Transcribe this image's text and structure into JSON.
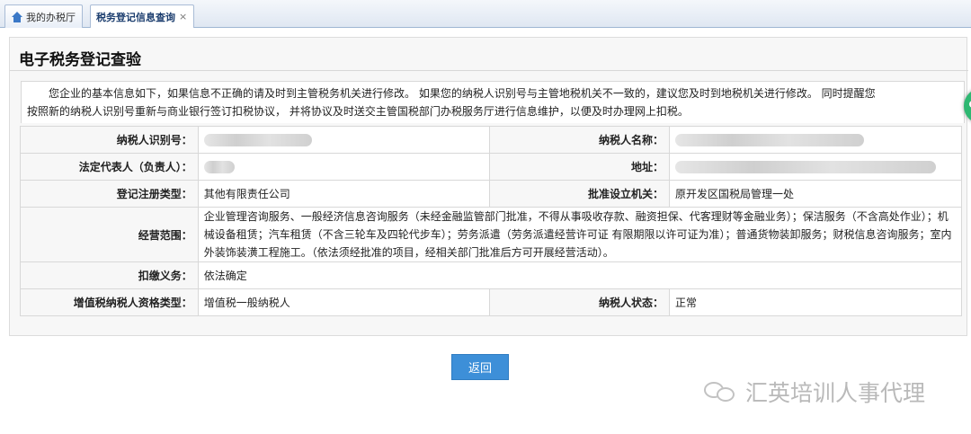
{
  "tabs": {
    "home_label": "我的办税厅",
    "active_label": "税务登记信息查询",
    "close_glyph": "×"
  },
  "panel": {
    "title": "电子税务登记查验",
    "notice_line1": "您企业的基本信息如下，如果信息不正确的请及时到主管税务机关进行修改。 如果您的纳税人识别号与主管地税机关不一致的，建议您及时到地税机关进行修改。 同时提醒您",
    "notice_line2": "按照新的纳税人识别号重新与商业银行签订扣税协议， 并将协议及时送交主管国税部门办税服务厅进行信息维护，以便及时办理网上扣税。"
  },
  "info": {
    "taxpayer_id_label": "纳税人识别号：",
    "taxpayer_name_label": "纳税人名称：",
    "legal_rep_label": "法定代表人（负责人）：",
    "address_label": "地址：",
    "reg_type_label": "登记注册类型：",
    "reg_type_value": "其他有限责任公司",
    "approval_org_label": "批准设立机关：",
    "approval_org_value": "原开发区国税局管理一处",
    "scope_label": "经营范围：",
    "scope_value": "企业管理咨询服务、一般经济信息咨询服务（未经金融监管部门批准，不得从事吸收存款、融资担保、代客理财等金融业务）；保洁服务（不含高处作业）；机械设备租赁；汽车租赁（不含三轮车及四轮代步车）；劳务派遣（劳务派遣经营许可证 有限期限以许可证为准）；普通货物装卸服务；财税信息咨询服务；室内外装饰装潢工程施工。（依法须经批准的项目，经相关部门批准后方可开展经营活动）。",
    "withholding_label": "扣缴义务：",
    "withholding_value": "依法确定",
    "vat_type_label": "增值税纳税人资格类型：",
    "vat_type_value": "增值税一般纳税人",
    "status_label": "纳税人状态：",
    "status_value": "正常"
  },
  "actions": {
    "back_label": "返回"
  },
  "watermark": {
    "text": "汇英培训人事代理"
  }
}
